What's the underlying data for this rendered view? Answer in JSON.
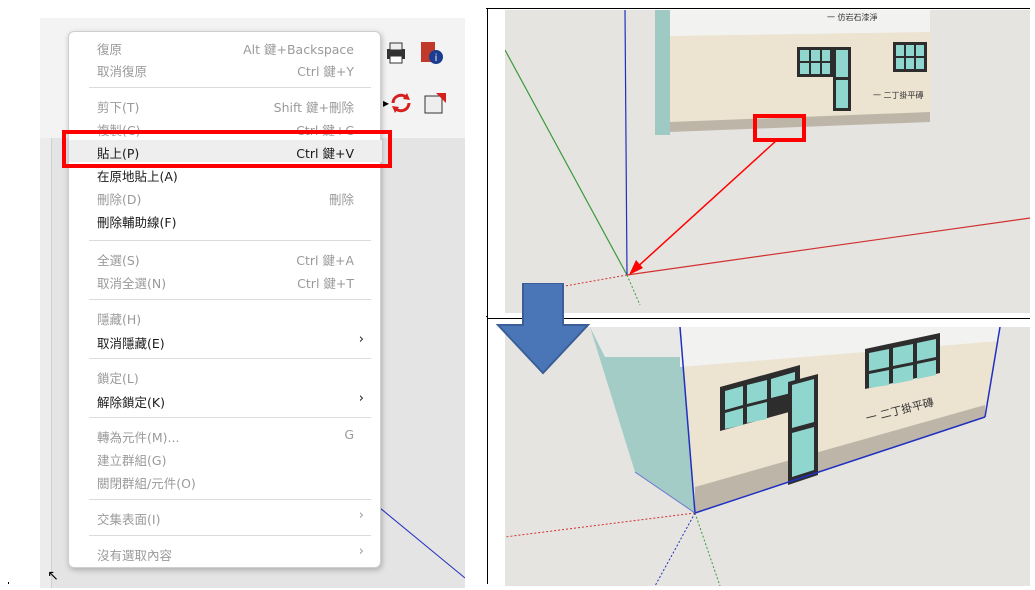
{
  "left": {
    "context_menu": {
      "items": [
        {
          "label": "復原",
          "shortcut": "Alt 鍵+Backspace",
          "disabled": true,
          "submenu": false
        },
        {
          "label": "取消復原",
          "shortcut": "Ctrl 鍵+Y",
          "disabled": true,
          "submenu": false
        },
        {
          "label": "剪下(T)",
          "shortcut": "Shift 鍵+刪除",
          "disabled": true,
          "submenu": false
        },
        {
          "label": "複製(C)",
          "shortcut": "Ctrl 鍵+C",
          "disabled": true,
          "submenu": false
        },
        {
          "label": "貼上(P)",
          "shortcut": "Ctrl 鍵+V",
          "disabled": false,
          "submenu": false,
          "highlighted": true
        },
        {
          "label": "在原地貼上(A)",
          "shortcut": "",
          "disabled": false,
          "submenu": false
        },
        {
          "label": "刪除(D)",
          "shortcut": "刪除",
          "disabled": true,
          "submenu": false
        },
        {
          "label": "刪除輔助線(F)",
          "shortcut": "",
          "disabled": false,
          "submenu": false
        },
        {
          "label": "全選(S)",
          "shortcut": "Ctrl 鍵+A",
          "disabled": true,
          "submenu": false
        },
        {
          "label": "取消全選(N)",
          "shortcut": "Ctrl 鍵+T",
          "disabled": true,
          "submenu": false
        },
        {
          "label": "隱藏(H)",
          "shortcut": "",
          "disabled": true,
          "submenu": false
        },
        {
          "label": "取消隱藏(E)",
          "shortcut": "",
          "disabled": false,
          "submenu": true
        },
        {
          "label": "鎖定(L)",
          "shortcut": "",
          "disabled": true,
          "submenu": false
        },
        {
          "label": "解除鎖定(K)",
          "shortcut": "",
          "disabled": false,
          "submenu": true
        },
        {
          "label": "轉為元件(M)...",
          "shortcut": "G",
          "disabled": true,
          "submenu": false
        },
        {
          "label": "建立群組(G)",
          "shortcut": "",
          "disabled": true,
          "submenu": false
        },
        {
          "label": "關閉群組/元件(O)",
          "shortcut": "",
          "disabled": true,
          "submenu": false
        },
        {
          "label": "交集表面(I)",
          "shortcut": "",
          "disabled": true,
          "submenu": true
        },
        {
          "label": "沒有選取內容",
          "shortcut": "",
          "disabled": true,
          "submenu": true
        }
      ],
      "submenu_arrow": "›"
    },
    "toolbar_icons": [
      "printer-icon",
      "model-info-icon",
      "refresh-icon",
      "export-icon"
    ]
  },
  "right_top": {
    "sign_top": "一 仿岩石漆淨",
    "sign_wall": "一 二丁掛平磚"
  },
  "right_bottom": {
    "sign_wall": "一 二丁掛平磚"
  },
  "colors": {
    "highlight_red": "#ff0000",
    "arrow_blue": "#4a76b8",
    "axis_red": "#d03030",
    "axis_green": "#3a9a3a",
    "axis_blue": "#2030c0"
  }
}
